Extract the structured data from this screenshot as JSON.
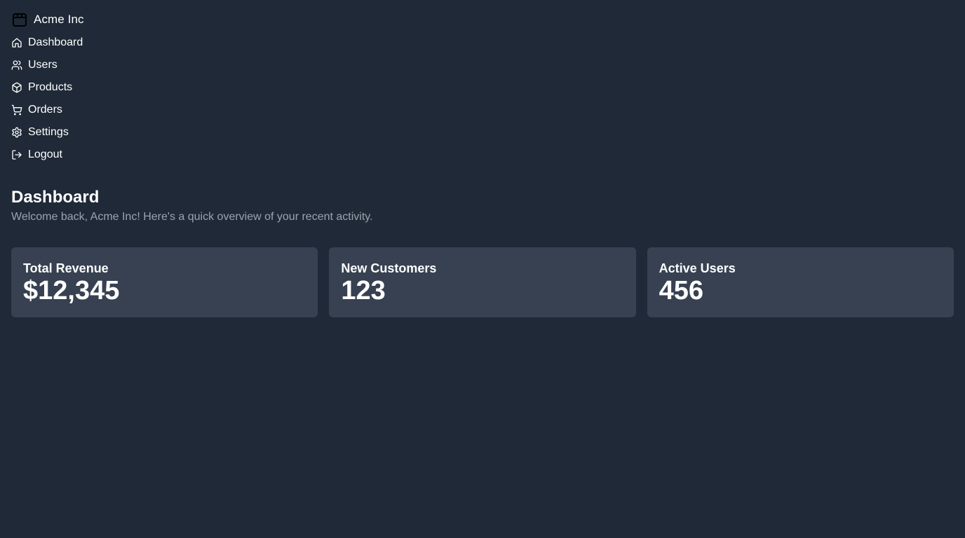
{
  "brand": {
    "name": "Acme Inc",
    "icon": "package-box-icon"
  },
  "nav": {
    "items": [
      {
        "label": "Dashboard",
        "icon": "home-icon"
      },
      {
        "label": "Users",
        "icon": "users-icon"
      },
      {
        "label": "Products",
        "icon": "cube-icon"
      },
      {
        "label": "Orders",
        "icon": "cart-icon"
      },
      {
        "label": "Settings",
        "icon": "gear-icon"
      },
      {
        "label": "Logout",
        "icon": "logout-icon"
      }
    ]
  },
  "header": {
    "title": "Dashboard",
    "subtitle": "Welcome back, Acme Inc! Here's a quick overview of your recent activity."
  },
  "cards": [
    {
      "title": "Total Revenue",
      "value": "$12,345"
    },
    {
      "title": "New Customers",
      "value": "123"
    },
    {
      "title": "Active Users",
      "value": "456"
    }
  ],
  "colors": {
    "background": "#1f2937",
    "card": "#374151",
    "text": "#ffffff",
    "muted": "#9ca3af"
  }
}
